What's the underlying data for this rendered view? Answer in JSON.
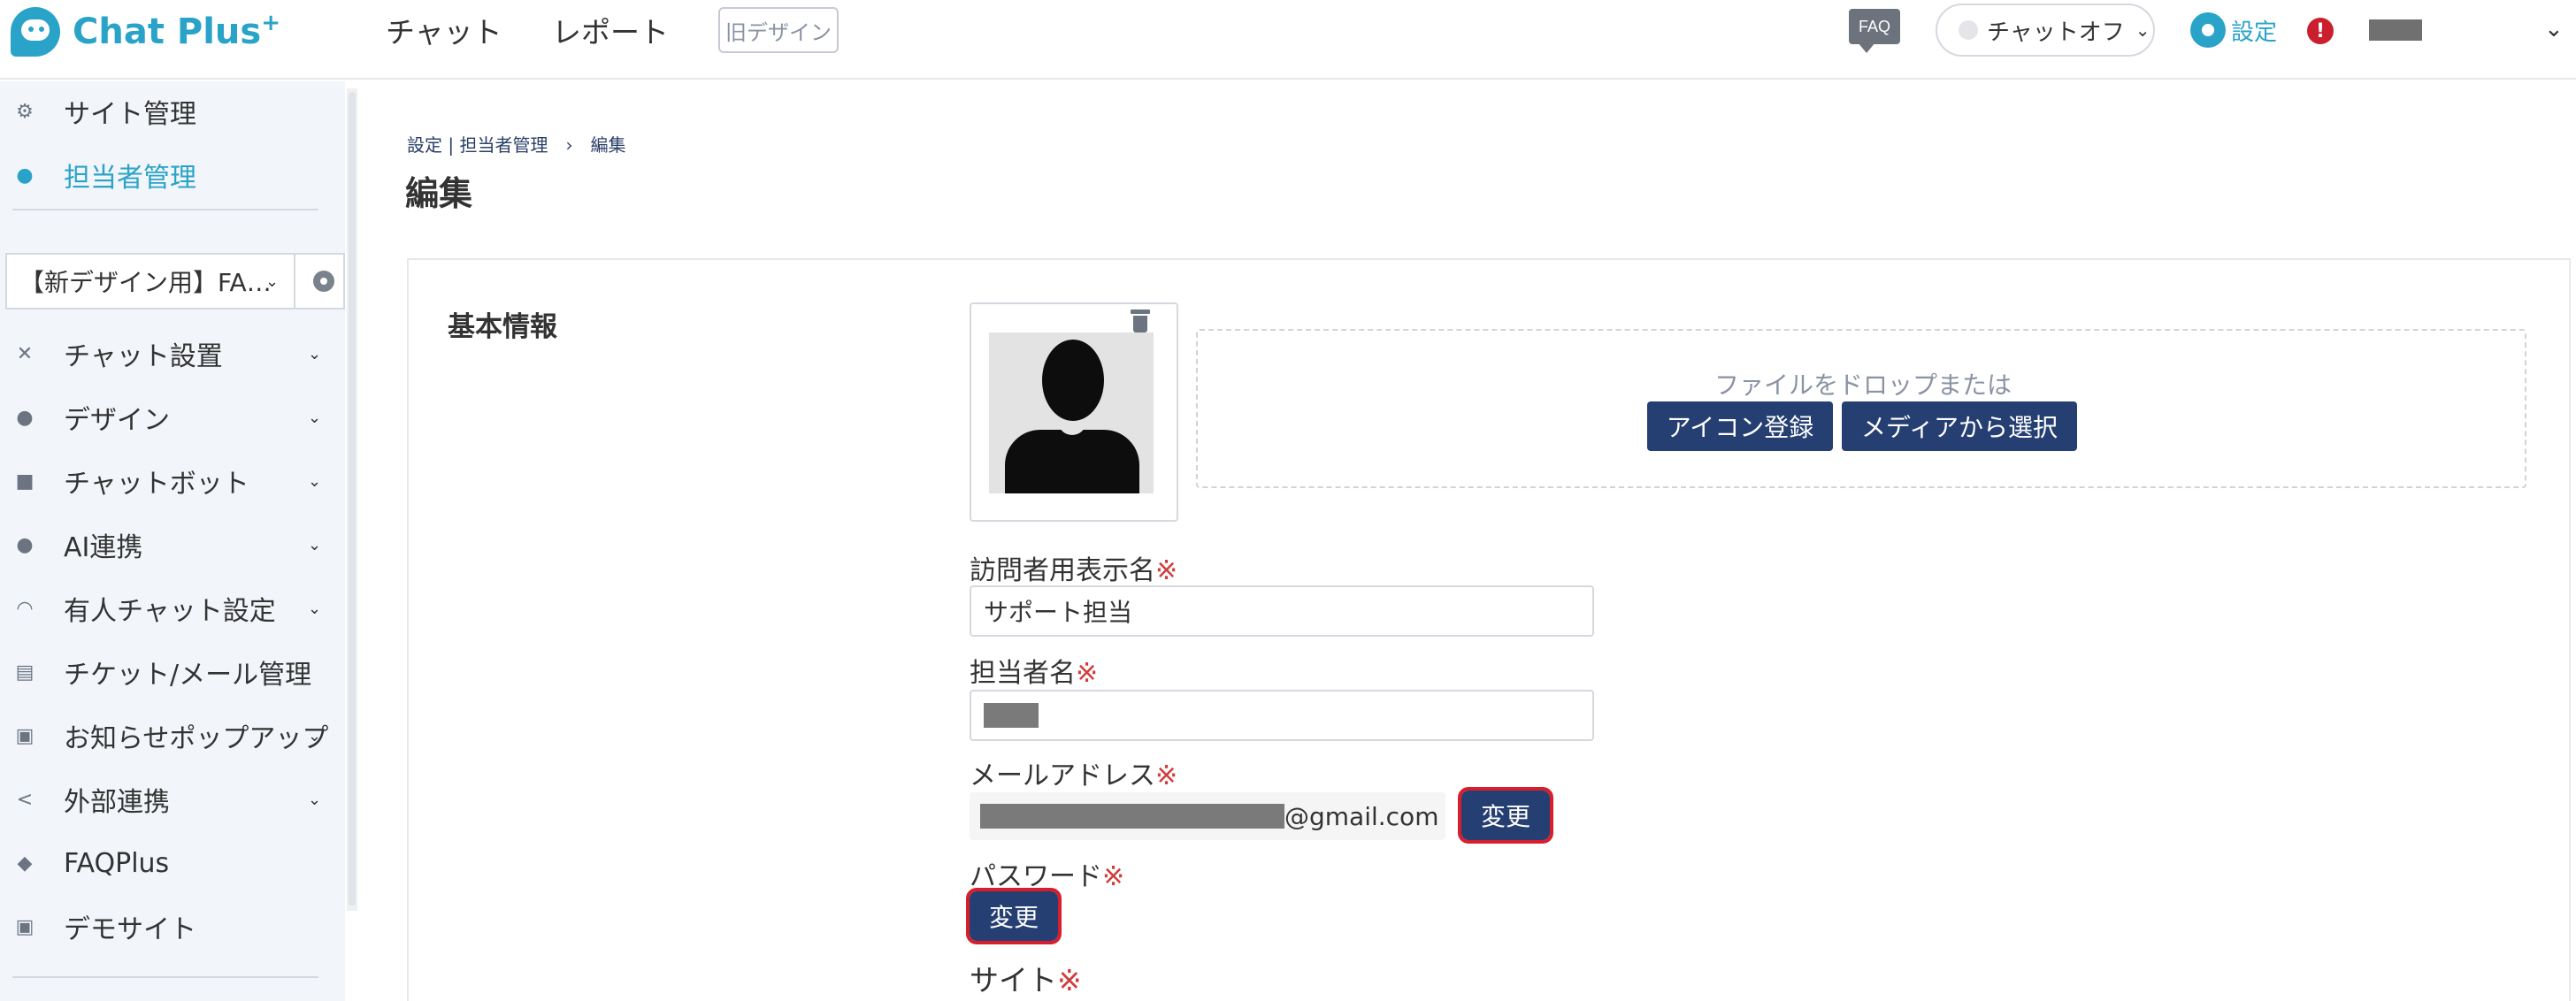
{
  "header": {
    "logo_text": "Chat Plus",
    "logo_plus": "+",
    "nav": [
      "チャット",
      "レポート"
    ],
    "old_design": "旧デザイン",
    "faq": "FAQ",
    "chat_status": "チャットオフ",
    "settings_label": "設定",
    "alert": "!"
  },
  "sidebar": {
    "top_items": [
      {
        "label": "サイト管理",
        "icon": "gear-icon"
      },
      {
        "label": "担当者管理",
        "icon": "user-gear-icon",
        "active": true
      }
    ],
    "site_select": "【新デザイン用】FA…",
    "menu": [
      {
        "label": "チャット設置",
        "icon": "tools-icon",
        "caret": true
      },
      {
        "label": "デザイン",
        "icon": "palette-icon",
        "caret": true
      },
      {
        "label": "チャットボット",
        "icon": "chat-bubbles-icon",
        "caret": true
      },
      {
        "label": "AI連携",
        "icon": "lightbulb-icon",
        "caret": true
      },
      {
        "label": "有人チャット設定",
        "icon": "headset-icon",
        "caret": true
      },
      {
        "label": "チケット/メール管理",
        "icon": "list-icon",
        "caret": false
      },
      {
        "label": "お知らせポップアップ",
        "icon": "window-icon",
        "caret": true
      },
      {
        "label": "外部連携",
        "icon": "share-icon",
        "caret": true
      },
      {
        "label": "FAQPlus",
        "icon": "shield-icon",
        "caret": false
      },
      {
        "label": "デモサイト",
        "icon": "eye-icon",
        "caret": false
      }
    ]
  },
  "main": {
    "breadcrumb": "設定 | 担当者管理　›　編集",
    "title": "編集",
    "section_title": "基本情報",
    "drop_text": "ファイルをドロップまたは",
    "btn_icon_register": "アイコン登録",
    "btn_media_select": "メディアから選択",
    "fields": {
      "visitor_name_label": "訪問者用表示名",
      "visitor_name_value": "サポート担当",
      "agent_name_label": "担当者名",
      "email_label": "メールアドレス",
      "email_suffix": "@gmail.com",
      "password_label": "パスワード",
      "site_label": "サイト",
      "required_mark": "※",
      "change_label": "変更"
    }
  },
  "colors": {
    "accent": "#2aa3c9",
    "navy_button": "#253f72",
    "highlight_red": "#d81e2c",
    "required_red": "#d33b3b"
  }
}
